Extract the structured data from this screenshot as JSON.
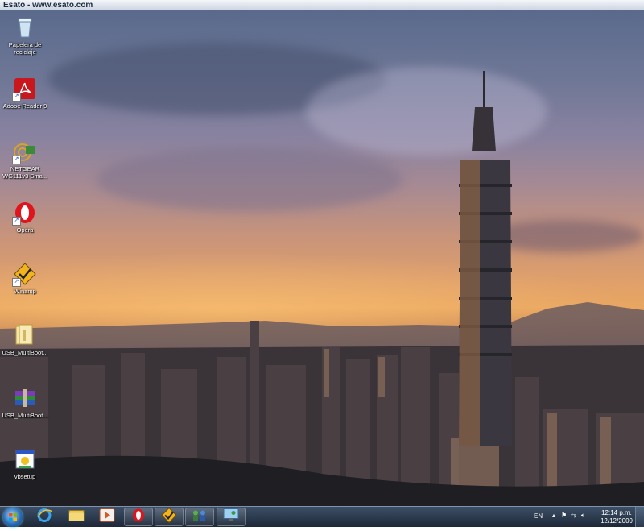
{
  "window": {
    "title": "Esato - www.esato.com"
  },
  "desktop_icons": [
    {
      "label": "Papelera de reciclaje",
      "icon": "recycle-bin-icon"
    },
    {
      "label": "Adobe Reader 9",
      "icon": "adobe-reader-icon"
    },
    {
      "label": "NETGEAR WG111v3 Sma...",
      "icon": "netgear-icon"
    },
    {
      "label": "Opera",
      "icon": "opera-icon"
    },
    {
      "label": "Winamp",
      "icon": "winamp-icon"
    },
    {
      "label": "USB_MultiBoot...",
      "icon": "folder-icon"
    },
    {
      "label": "USB_MultiBoot...",
      "icon": "rar-archive-icon"
    },
    {
      "label": "vbsetup",
      "icon": "setup-icon"
    }
  ],
  "taskbar": {
    "pinned": [
      "internet-explorer-icon",
      "explorer-folder-icon",
      "media-player-icon",
      "opera-icon",
      "winamp-icon",
      "network-connect-icon",
      "remote-desktop-icon"
    ],
    "tray": {
      "language": "EN",
      "time": "12:14 p.m.",
      "date": "12/12/2009"
    }
  }
}
